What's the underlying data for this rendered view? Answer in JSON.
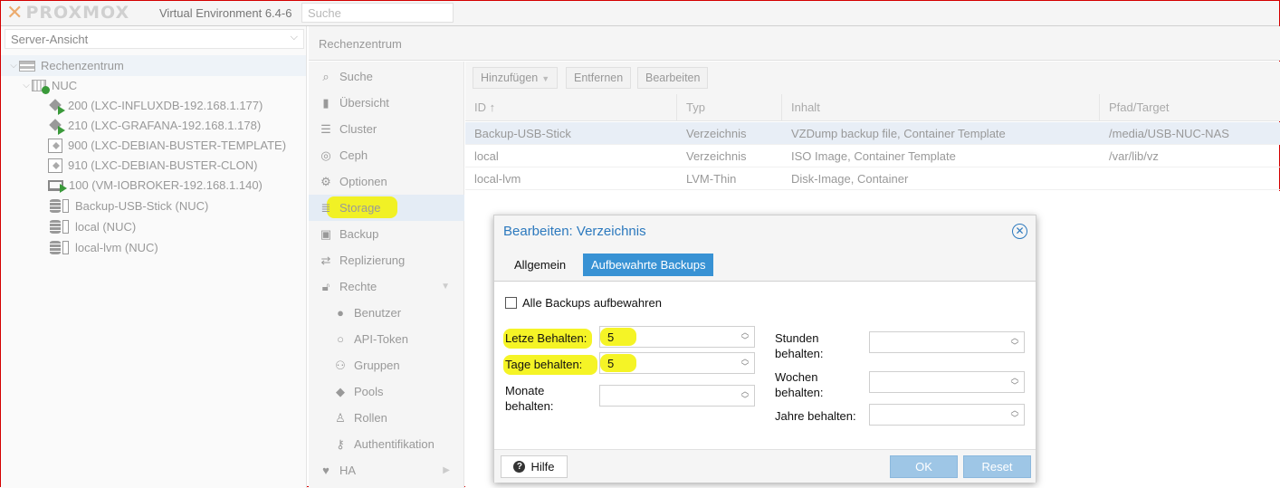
{
  "header": {
    "logo_text": "PROXMOX",
    "version": "Virtual Environment 6.4-6",
    "search_placeholder": "Suche"
  },
  "left": {
    "view_select": "Server-Ansicht",
    "tree": [
      {
        "label": "Rechenzentrum",
        "icon": "datacenter-icon"
      },
      {
        "label": "NUC",
        "icon": "node-icon"
      },
      {
        "label": "200 (LXC-INFLUXDB-192.168.1.177)",
        "icon": "container-running-icon"
      },
      {
        "label": "210 (LXC-GRAFANA-192.168.1.178)",
        "icon": "container-running-icon"
      },
      {
        "label": "900 (LXC-DEBIAN-BUSTER-TEMPLATE)",
        "icon": "template-icon"
      },
      {
        "label": "910 (LXC-DEBIAN-BUSTER-CLON)",
        "icon": "container-stopped-icon"
      },
      {
        "label": "100 (VM-IOBROKER-192.168.1.140)",
        "icon": "vm-running-icon"
      },
      {
        "label": "Backup-USB-Stick (NUC)",
        "icon": "storage-icon"
      },
      {
        "label": "local (NUC)",
        "icon": "storage-icon"
      },
      {
        "label": "local-lvm (NUC)",
        "icon": "storage-icon"
      }
    ]
  },
  "center": {
    "title": "Rechenzentrum",
    "menu": [
      {
        "label": "Suche",
        "icon": "search-icon"
      },
      {
        "label": "Übersicht",
        "icon": "book-icon"
      },
      {
        "label": "Cluster",
        "icon": "server-icon"
      },
      {
        "label": "Ceph",
        "icon": "ceph-icon"
      },
      {
        "label": "Optionen",
        "icon": "gear-icon"
      },
      {
        "label": "Storage",
        "icon": "database-icon"
      },
      {
        "label": "Backup",
        "icon": "floppy-icon"
      },
      {
        "label": "Replizierung",
        "icon": "retweet-icon"
      },
      {
        "label": "Rechte",
        "icon": "unlock-icon"
      },
      {
        "label": "Benutzer",
        "icon": "user-icon"
      },
      {
        "label": "API-Token",
        "icon": "user-outline-icon"
      },
      {
        "label": "Gruppen",
        "icon": "users-icon"
      },
      {
        "label": "Pools",
        "icon": "tags-icon"
      },
      {
        "label": "Rollen",
        "icon": "male-icon"
      },
      {
        "label": "Authentifikation",
        "icon": "key-icon"
      },
      {
        "label": "HA",
        "icon": "heartbeat-icon"
      }
    ]
  },
  "toolbar": {
    "add": "Hinzufügen",
    "remove": "Entfernen",
    "edit": "Bearbeiten"
  },
  "grid": {
    "columns": [
      "ID ↑",
      "Typ",
      "Inhalt",
      "Pfad/Target"
    ],
    "rows": [
      [
        "Backup-USB-Stick",
        "Verzeichnis",
        "VZDump backup file, Container Template",
        "/media/USB-NUC-NAS"
      ],
      [
        "local",
        "Verzeichnis",
        "ISO Image, Container Template",
        "/var/lib/vz"
      ],
      [
        "local-lvm",
        "LVM-Thin",
        "Disk-Image, Container",
        ""
      ]
    ]
  },
  "dialog": {
    "title": "Bearbeiten: Verzeichnis",
    "tab_general": "Allgemein",
    "tab_backups": "Aufbewahrte Backups",
    "keep_all": "Alle Backups aufbewahren",
    "keep_last_label": "Letze Behalten:",
    "keep_last": "5",
    "keep_daily_label": "Tage behalten:",
    "keep_daily": "5",
    "keep_monthly_label": "Monate behalten:",
    "keep_monthly": "",
    "keep_hourly_label": "Stunden behalten:",
    "keep_hourly": "",
    "keep_weekly_label": "Wochen behalten:",
    "keep_weekly": "",
    "keep_yearly_label": "Jahre behalten:",
    "keep_yearly": "",
    "help": "Hilfe",
    "ok": "OK",
    "reset": "Reset"
  },
  "colors": {
    "accent": "#3892d4",
    "title_blue": "#2c79be",
    "highlight": "#f3f200"
  }
}
